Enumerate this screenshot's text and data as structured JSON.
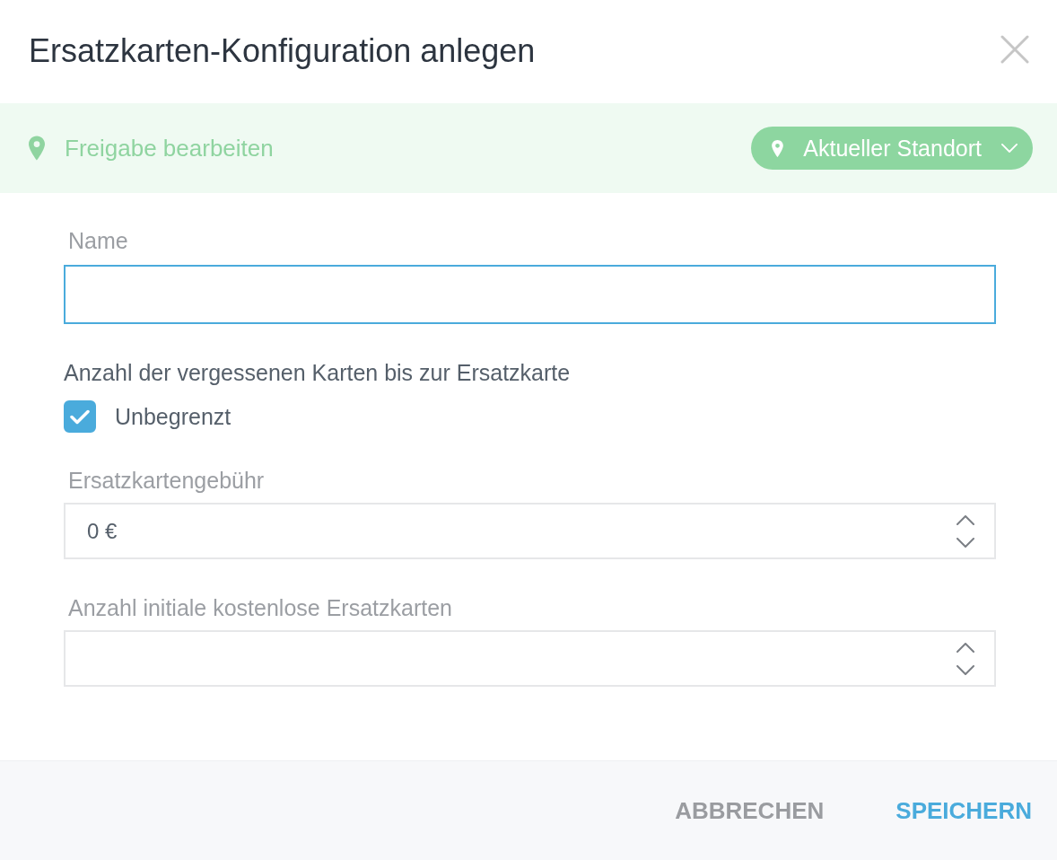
{
  "dialog": {
    "title": "Ersatzkarten-Konfiguration anlegen"
  },
  "share_bar": {
    "label": "Freigabe bearbeiten",
    "location_dropdown": {
      "label": "Aktueller Standort"
    }
  },
  "form": {
    "fields": [
      {
        "kind": "text",
        "label": "Name",
        "focused": true
      },
      {
        "kind": "checkbox",
        "label": "Anzahl der vergessenen Karten bis zur Ersatzkarte",
        "checkbox": {
          "label": "Unbegrenzt",
          "checked": true
        }
      },
      {
        "kind": "number",
        "label": "Ersatzkartengebühr",
        "value": "0 €",
        "focused": false
      },
      {
        "kind": "number",
        "label": "Anzahl initiale kostenlose Ersatzkarten",
        "focused": false
      }
    ]
  },
  "footer": {
    "buttons": [
      {
        "kind": "secondary",
        "label": "ABBRECHEN"
      },
      {
        "kind": "primary",
        "label": "SPEICHERN"
      }
    ]
  }
}
